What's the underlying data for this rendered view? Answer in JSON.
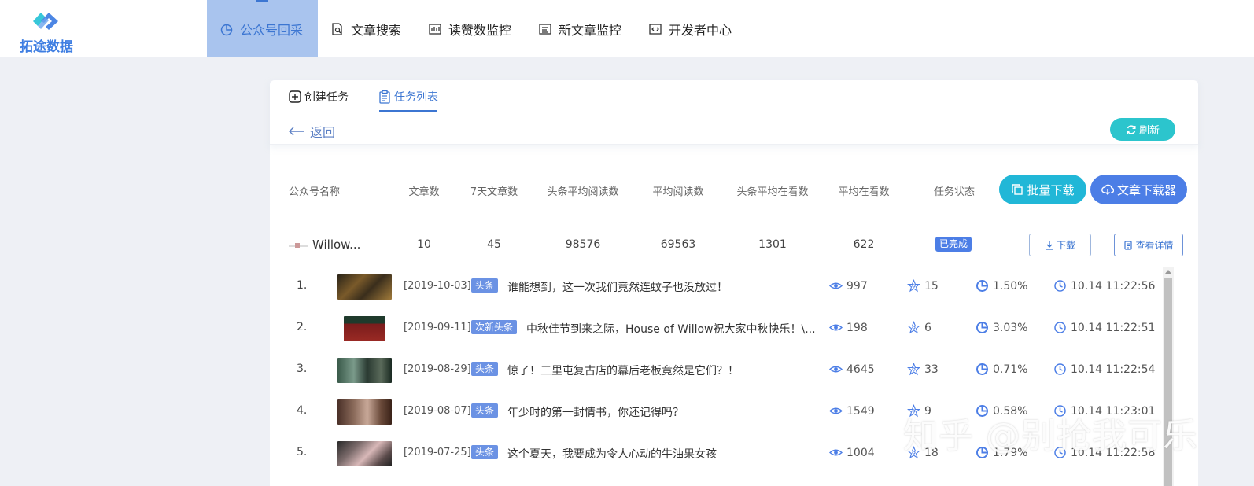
{
  "logo": {
    "text": "拓途数据"
  },
  "nav": {
    "items": [
      {
        "label": "公众号回采",
        "icon": "pie-chart-icon",
        "active": true
      },
      {
        "label": "文章搜索",
        "icon": "document-search-icon"
      },
      {
        "label": "读赞数监控",
        "icon": "bar-monitor-icon"
      },
      {
        "label": "新文章监控",
        "icon": "list-monitor-icon"
      },
      {
        "label": "开发者中心",
        "icon": "code-icon"
      }
    ]
  },
  "tabs": {
    "create": "创建任务",
    "list": "任务列表"
  },
  "back_label": "返回",
  "refresh_label": "刷新",
  "table": {
    "headers": [
      "公众号名称",
      "文章数",
      "7天文章数",
      "头条平均阅读数",
      "平均阅读数",
      "头条平均在看数",
      "平均在看数",
      "任务状态"
    ],
    "batch_download": "批量下载",
    "article_downloader": "文章下载器"
  },
  "account": {
    "name": "Willow...",
    "article_count": "10",
    "week_articles": "45",
    "headline_avg_read": "98576",
    "avg_read": "69563",
    "headline_avg_watch": "1301",
    "avg_watch": "622",
    "status": "已完成",
    "download_label": "下载",
    "detail_label": "查看详情"
  },
  "articles": [
    {
      "index": "1.",
      "date": "[2019-10-03]",
      "tag": "头条",
      "title": "谁能想到，这一次我们竟然连蚊子也没放过！",
      "reads": "997",
      "likes": "15",
      "rate": "1.50%",
      "time": "10.14 11:22:56"
    },
    {
      "index": "2.",
      "date": "[2019-09-11]",
      "tag": "次新头条",
      "title": "中秋佳节到来之际，House of Willow祝大家中秋快乐！\\...",
      "reads": "198",
      "likes": "6",
      "rate": "3.03%",
      "time": "10.14 11:22:51"
    },
    {
      "index": "3.",
      "date": "[2019-08-29]",
      "tag": "头条",
      "title": "惊了！三里屯复古店的幕后老板竟然是它们？！",
      "reads": "4645",
      "likes": "33",
      "rate": "0.71%",
      "time": "10.14 11:22:54"
    },
    {
      "index": "4.",
      "date": "[2019-08-07]",
      "tag": "头条",
      "title": "年少时的第一封情书，你还记得吗？",
      "reads": "1549",
      "likes": "9",
      "rate": "0.58%",
      "time": "10.14 11:23:01"
    },
    {
      "index": "5.",
      "date": "[2019-07-25]",
      "tag": "头条",
      "title": "这个夏天，我要成为令人心动的牛油果女孩",
      "reads": "1004",
      "likes": "18",
      "rate": "1.79%",
      "time": "10.14 11:22:58"
    }
  ],
  "watermark": "知乎 @别抢我可乐",
  "colors": {
    "accent": "#4c7ee6",
    "teal": "#21b7d7",
    "nav_active_bg": "#a9c4ee"
  }
}
